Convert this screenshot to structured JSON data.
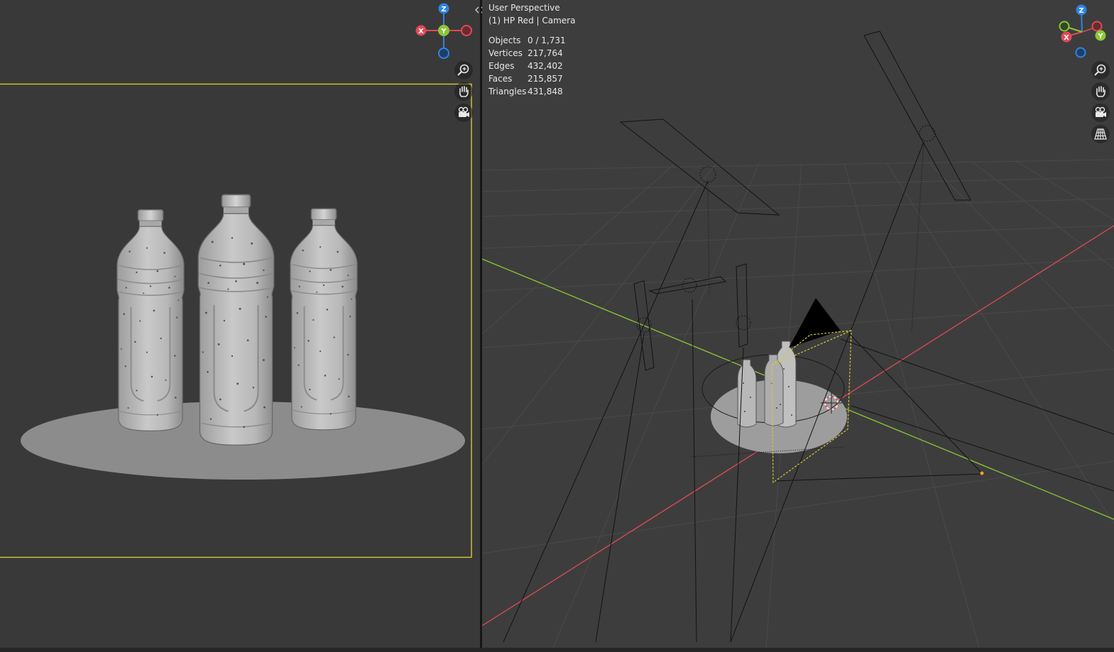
{
  "colors": {
    "axis_x": "#e04a56",
    "axis_y": "#8ac734",
    "axis_z": "#2f84e0",
    "camera_frame": "#d8c832",
    "viewport_bg": "#3d3d3d",
    "camera_view_bg": "#393939"
  },
  "gizmo": {
    "x_label": "X",
    "y_label": "Y",
    "z_label": "Z"
  },
  "left_viewport": {
    "nav_icons": [
      "zoom-icon",
      "hand-pan-icon",
      "camera-icon"
    ]
  },
  "right_viewport": {
    "view_name": "User Perspective",
    "object_info": "(1) HP Red | Camera",
    "stats": [
      {
        "label": "Objects",
        "value": "0 / 1,731"
      },
      {
        "label": "Vertices",
        "value": "217,764"
      },
      {
        "label": "Edges",
        "value": "432,402"
      },
      {
        "label": "Faces",
        "value": "215,857"
      },
      {
        "label": "Triangles",
        "value": "431,848"
      }
    ],
    "nav_icons": [
      "zoom-icon",
      "hand-pan-icon",
      "camera-icon",
      "grid-perspective-icon"
    ]
  }
}
